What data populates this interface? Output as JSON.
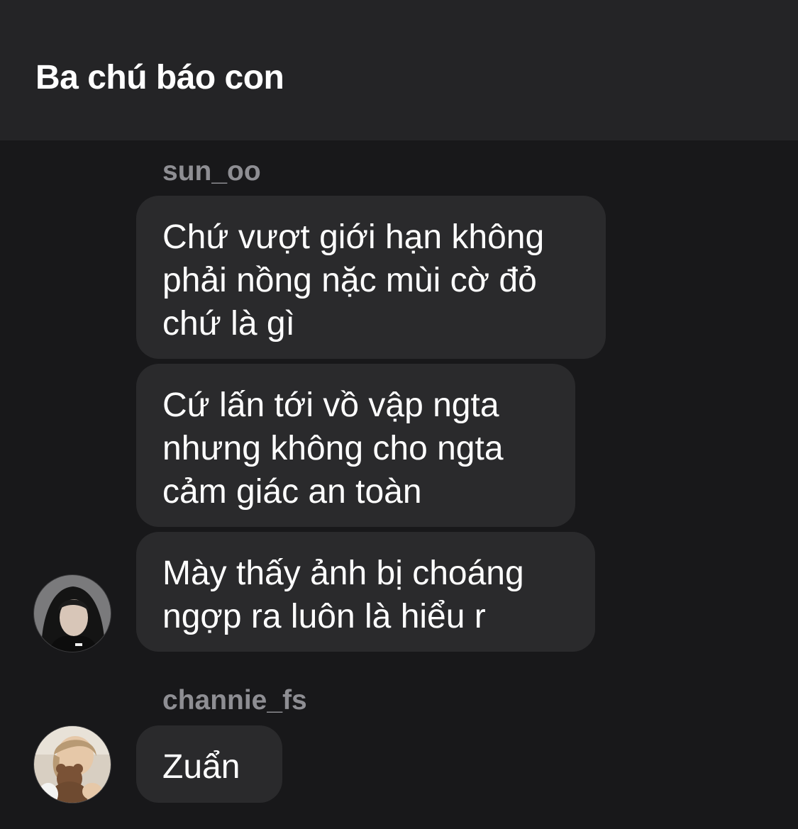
{
  "header": {
    "title": "Ba chú báo con"
  },
  "messages": [
    {
      "sender": "sun_oo",
      "bubbles": [
        {
          "text": "Chứ vượt giới hạn không\nphải nồng nặc mùi cờ đỏ\nchứ là gì"
        },
        {
          "text": "Cứ lấn tới vồ vập ngta\nnhưng không cho ngta\ncảm giác an toàn"
        },
        {
          "text": "Mày thấy ảnh bị choáng\nngợp ra luôn là hiểu r"
        }
      ],
      "avatar_icon": "avatar-hooded-person"
    },
    {
      "sender": "channie_fs",
      "bubbles": [
        {
          "text": "Zuẩn"
        }
      ],
      "avatar_icon": "avatar-person-with-teddy-bear"
    }
  ],
  "colors": {
    "background": "#18181a",
    "header_background": "#242426",
    "bubble_background": "#2a2a2c",
    "sender_text": "#8e8e93",
    "message_text": "#ffffff"
  }
}
